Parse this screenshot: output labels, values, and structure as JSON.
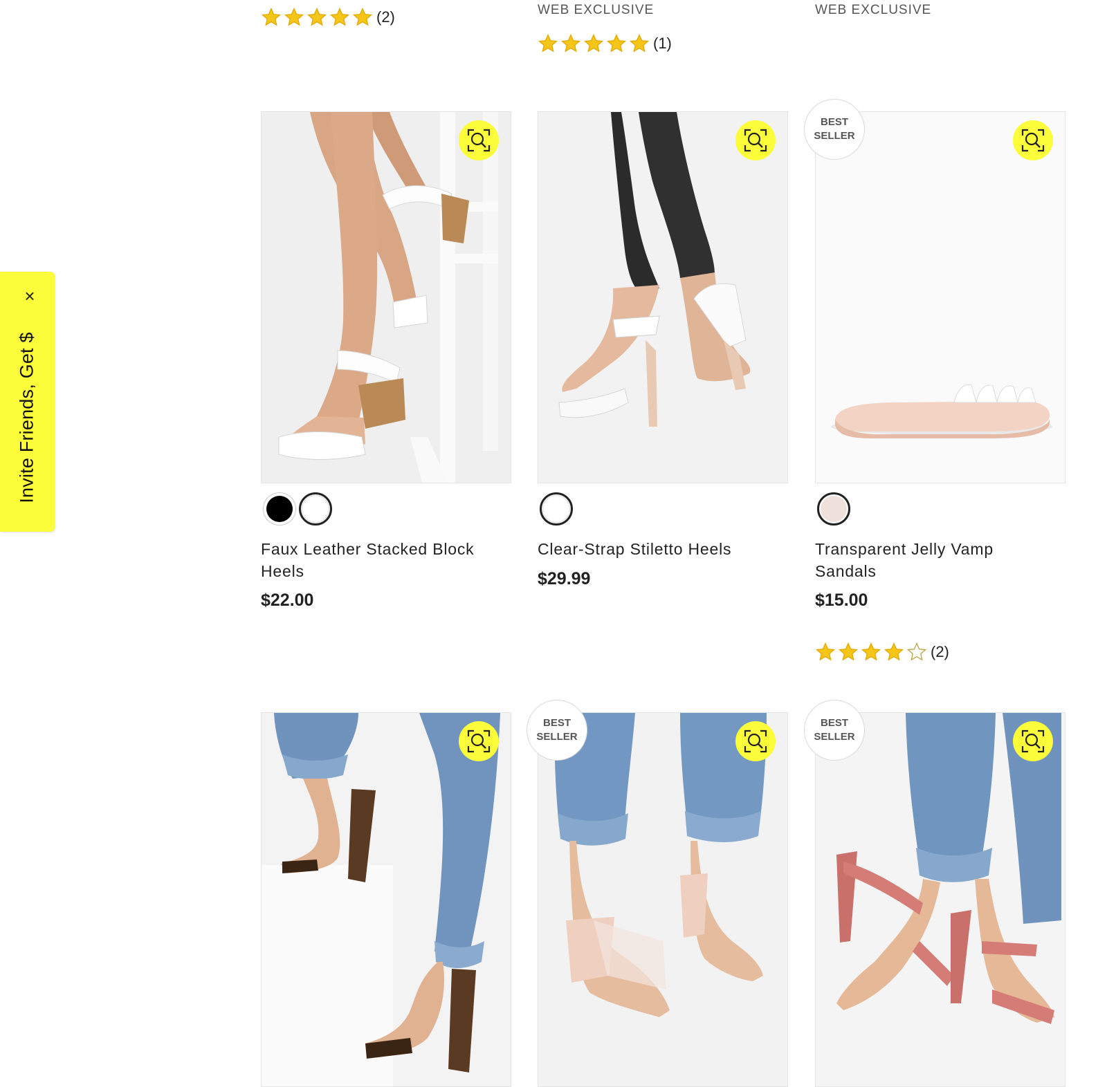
{
  "invite": {
    "label": "Invite Friends, Get $",
    "close": "×"
  },
  "top_row": [
    {
      "web_exclusive": "",
      "rating": 5,
      "count": "(2)"
    },
    {
      "web_exclusive": "WEB EXCLUSIVE",
      "rating": 5,
      "count": "(1)"
    },
    {
      "web_exclusive": "WEB EXCLUSIVE",
      "rating": 0,
      "count": ""
    }
  ],
  "products": [
    {
      "name": "Faux Leather Stacked Block Heels",
      "price": "$22.00",
      "badge": "",
      "swatches": [
        "#000000",
        "#ffffff"
      ],
      "selected": 1,
      "rating": 0,
      "count": ""
    },
    {
      "name": "Clear-Strap Stiletto Heels",
      "price": "$29.99",
      "badge": "",
      "swatches": [
        "#ffffff"
      ],
      "selected": 0,
      "rating": 0,
      "count": ""
    },
    {
      "name": "Transparent Jelly Vamp Sandals",
      "price": "$15.00",
      "badge": "BEST SELLER",
      "swatches": [
        "#efe2dc"
      ],
      "selected": 0,
      "rating": 4,
      "count": "(2)"
    }
  ],
  "bottom_row": [
    {
      "badge": ""
    },
    {
      "badge": "BEST SELLER"
    },
    {
      "badge": "BEST SELLER"
    }
  ],
  "badge_lines": [
    "BEST",
    "SELLER"
  ],
  "colors": {
    "accent_yellow": "#fbfd3a",
    "star": "#f5c518"
  }
}
